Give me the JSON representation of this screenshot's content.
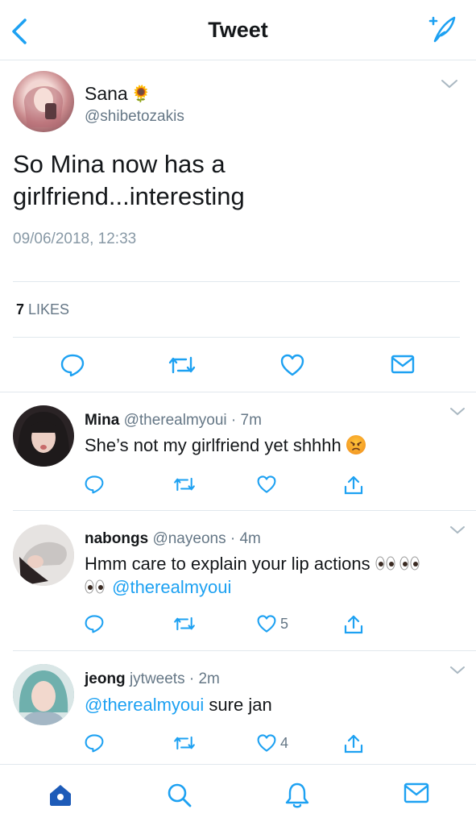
{
  "header": {
    "title": "Tweet",
    "back_icon": "chevron-left-icon",
    "compose_icon": "compose-tweet-icon"
  },
  "tweet": {
    "name": "Sana",
    "name_emoji": "🌻",
    "handle": "@shibetozakis",
    "text": "So Mina now has a girlfriend...interesting",
    "timestamp": "09/06/2018, 12:33",
    "likes_count": "7",
    "likes_label": "LIKES"
  },
  "replies": [
    {
      "name": "Mina",
      "handle": "@therealmyoui",
      "time": "· 7m",
      "text": "She’s not my girlfriend yet shhhh",
      "emoji": "angry-face",
      "like_count": ""
    },
    {
      "name": "nabongs",
      "handle": "@nayeons",
      "time": "· 4m",
      "text": "Hmm care to explain your lip actions",
      "emoji": "eyes",
      "mention": "@therealmyoui",
      "like_count": "5"
    },
    {
      "name": "jeong",
      "handle": "jytweets",
      "time": "· 2m",
      "mention": "@therealmyoui",
      "text": "sure jan",
      "like_count": "4"
    }
  ],
  "tabbar": {
    "items": [
      "home-icon",
      "search-icon",
      "notifications-icon",
      "messages-icon"
    ],
    "active": "home-icon"
  },
  "colors": {
    "accent": "#1da1f2",
    "text": "#14171a",
    "secondary": "#657786"
  }
}
